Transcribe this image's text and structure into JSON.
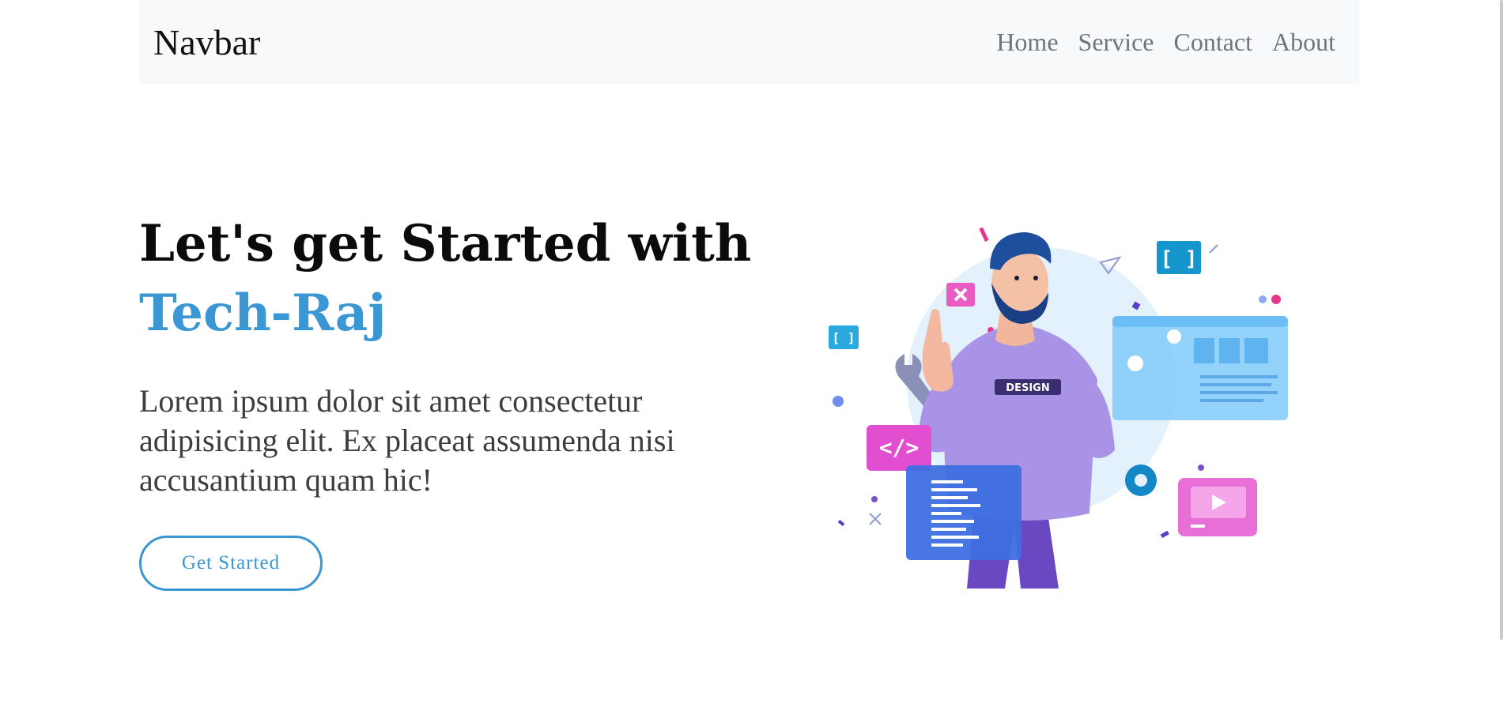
{
  "navbar": {
    "brand": "Navbar",
    "links": [
      "Home",
      "Service",
      "Contact",
      "About"
    ]
  },
  "hero": {
    "title_line1": "Let's get Started with",
    "title_highlight": "Tech-Raj",
    "description": "Lorem ipsum dolor sit amet consectetur adipisicing elit. Ex placeat assumenda nisi accusantium quam hic!",
    "cta_label": "Get Started",
    "accent_color": "#3b97d3"
  },
  "illustration": {
    "shirt_label": "DESIGN",
    "bracket_badge": "[ ]",
    "code_badge": "</>",
    "icons": [
      "brackets-icon",
      "code-icon",
      "wrench-icon",
      "gear-icon",
      "play-icon",
      "close-icon"
    ]
  }
}
